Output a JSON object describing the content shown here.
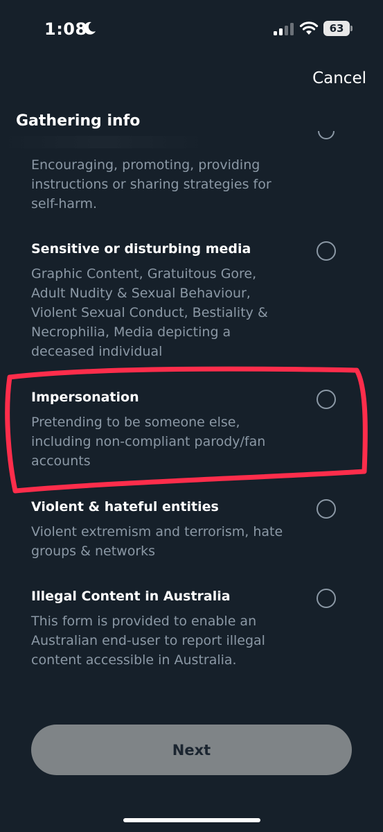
{
  "status_bar": {
    "time": "1:08",
    "battery": "63"
  },
  "header": {
    "cancel_label": "Cancel",
    "title": "Gathering info"
  },
  "top_partial": {
    "description": "Encouraging, promoting, providing\ninstructions or sharing strategies for\nself-harm."
  },
  "options": [
    {
      "title": "Sensitive or disturbing media",
      "description": "Graphic Content, Gratuitous Gore,\nAdult Nudity & Sexual Behaviour,\nViolent Sexual Conduct, Bestiality &\nNecrophilia, Media depicting a\ndeceased individual",
      "selected": false
    },
    {
      "title": "Impersonation",
      "description": "Pretending to be someone else,\nincluding non-compliant parody/fan\naccounts",
      "selected": false,
      "highlighted": true
    },
    {
      "title": "Violent & hateful entities",
      "description": "Violent extremism and terrorism, hate\ngroups & networks",
      "selected": false
    },
    {
      "title": "Illegal Content in Australia",
      "description": "This form is provided to enable an\nAustralian end-user to report illegal\ncontent accessible in Australia.",
      "selected": false
    }
  ],
  "footer": {
    "next_label": "Next"
  },
  "colors": {
    "background": "#16202a",
    "secondary_text": "#8b98a5",
    "highlight": "#ff2d4b",
    "next_button": "#7f8487"
  },
  "icons": {
    "moon": "moon-icon",
    "signal": "cellular-signal-icon",
    "wifi": "wifi-icon",
    "battery": "battery-icon",
    "radio": "radio-unselected-icon"
  }
}
